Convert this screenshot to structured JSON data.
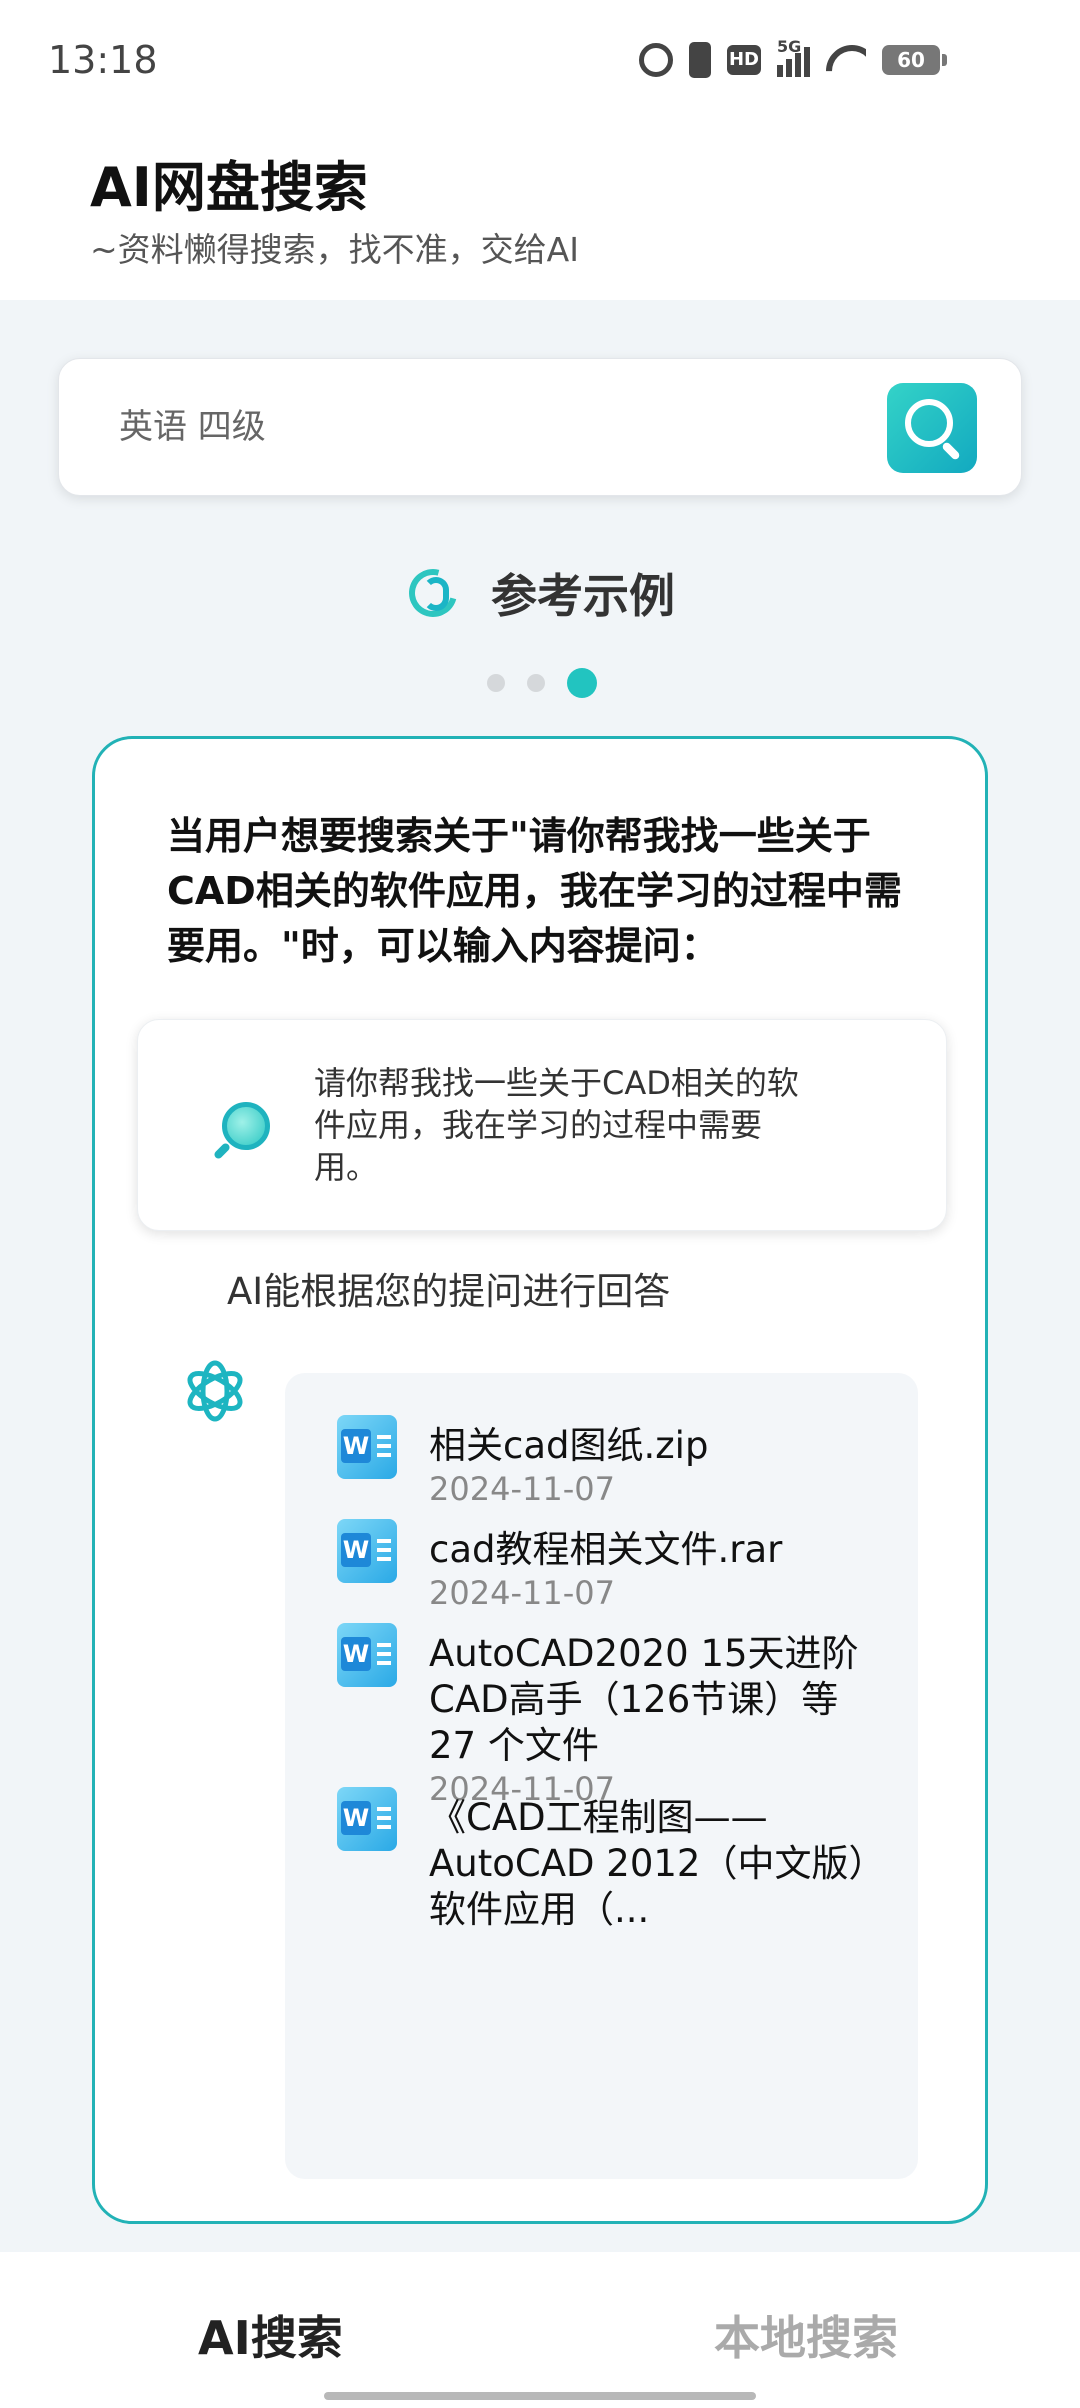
{
  "status_bar": {
    "time": "13:18",
    "network": "5G",
    "hd": "HD",
    "battery": "60"
  },
  "header": {
    "title": "AI网盘搜索",
    "subtitle": "~资料懒得搜索，找不准，交给AI"
  },
  "search": {
    "placeholder": "英语 四级",
    "button_icon": "search-icon"
  },
  "section": {
    "title": "参考示例",
    "icon": "paperclip-icon"
  },
  "carousel": {
    "page_count": 3,
    "active_index": 2
  },
  "example": {
    "intro": "当用户想要搜索关于\"请你帮我找一些关于CAD相关的软件应用，我在学习的过程中需要用。\"时，可以输入内容提问：",
    "query": "请你帮我找一些关于CAD相关的软件应用，我在学习的过程中需要用。",
    "ai_caption": "AI能根据您的提问进行回答",
    "results": [
      {
        "name": "相关cad图纸.zip",
        "date": "2024-11-07"
      },
      {
        "name": "cad教程相关文件.rar",
        "date": "2024-11-07"
      },
      {
        "name": "AutoCAD2020 15天进阶CAD高手（126节课）等 27 个文件",
        "date": "2024-11-07"
      },
      {
        "name": "《CAD工程制图——AutoCAD 2012（中文版）软件应用（...",
        "date": ""
      }
    ]
  },
  "tabs": {
    "ai": "AI搜索",
    "local": "本地搜索"
  },
  "colors": {
    "accent": "#22c4c0",
    "card_border": "#22b2b6",
    "inactive_tab": "#aaaaaa"
  }
}
